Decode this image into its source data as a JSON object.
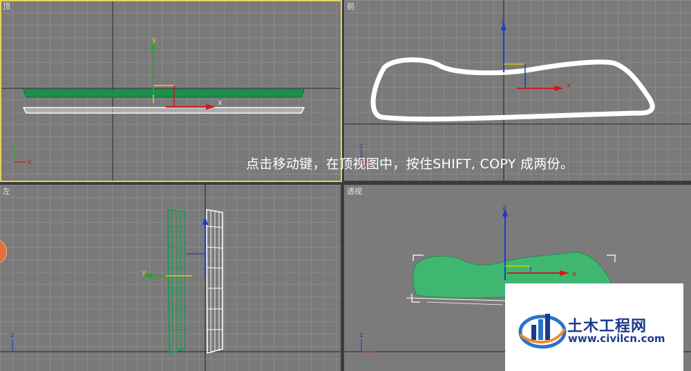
{
  "viewports": {
    "top": {
      "label": "顶"
    },
    "front": {
      "label": "前"
    },
    "left": {
      "label": "左"
    },
    "perspective": {
      "label": "透视"
    }
  },
  "axes": {
    "x": "x",
    "y": "y",
    "z": "z"
  },
  "caption": "点击移动键，在顶视图中，按住SHIFT, COPY 成两份。",
  "watermark": {
    "title": "土木工程网",
    "url": "www.civilcn.com"
  },
  "colors": {
    "viewport_bg": "#7a7a7a",
    "active_border": "#e6d35a",
    "selected_green": "#1f9a55",
    "wire_white": "#ffffff",
    "axis_red": "#d01818",
    "axis_green": "#22aa22",
    "axis_blue": "#1a3acc",
    "gizmo_yellow": "#e6d000"
  },
  "icons": [
    "move-gizmo-icon",
    "world-axis-icon",
    "site-logo-icon"
  ]
}
